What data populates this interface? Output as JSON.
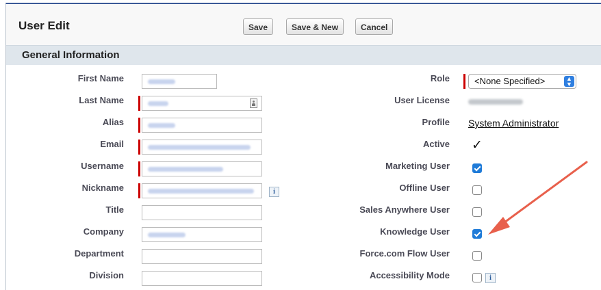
{
  "header": {
    "title": "User Edit",
    "save_label": "Save",
    "save_new_label": "Save & New",
    "cancel_label": "Cancel"
  },
  "section": {
    "title": "General Information"
  },
  "left_fields": {
    "first_name": "First Name",
    "last_name": "Last Name",
    "alias": "Alias",
    "email": "Email",
    "username": "Username",
    "nickname": "Nickname",
    "title": "Title",
    "company": "Company",
    "department": "Department",
    "division": "Division"
  },
  "right_fields": {
    "role": "Role",
    "role_value": "<None Specified>",
    "user_license": "User License",
    "profile": "Profile",
    "profile_value": "System Administrator",
    "active": "Active",
    "marketing_user": "Marketing User",
    "offline_user": "Offline User",
    "sales_anywhere_user": "Sales Anywhere User",
    "knowledge_user": "Knowledge User",
    "force_flow_user": "Force.com Flow User",
    "accessibility_mode": "Accessibility Mode"
  },
  "checkboxes": {
    "active": true,
    "marketing_user": true,
    "offline_user": false,
    "sales_anywhere_user": false,
    "knowledge_user": true,
    "force_flow_user": false,
    "accessibility_mode": false
  },
  "icons": {
    "info": "i",
    "lookup": "contact-card-icon",
    "select_arrows": "updown-chevron-icon"
  },
  "colors": {
    "required": "#cc0000",
    "checkbox_on": "#1f7bd8",
    "annotation_arrow": "#e8604c",
    "section_bg": "#dfe6ec"
  }
}
